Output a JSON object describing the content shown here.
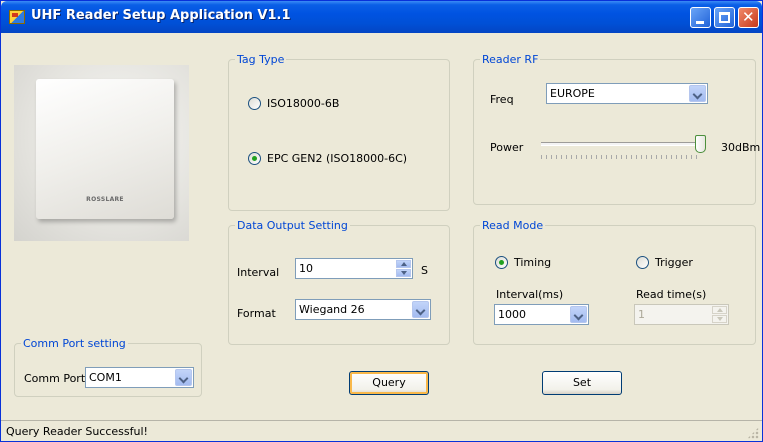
{
  "window": {
    "title": "UHF Reader Setup Application V1.1"
  },
  "photo": {
    "logo_text": "ROSSLARE"
  },
  "tag_type": {
    "legend": "Tag Type",
    "options": [
      {
        "label": "ISO18000-6B",
        "selected": false
      },
      {
        "label": "EPC GEN2 (ISO18000-6C)",
        "selected": true
      }
    ]
  },
  "reader_rf": {
    "legend": "Reader RF",
    "freq_label": "Freq",
    "freq_value": "EUROPE",
    "power_label": "Power",
    "power_value": "30dBm",
    "power_level": 1.0
  },
  "data_output": {
    "legend": "Data Output Setting",
    "interval_label": "Interval",
    "interval_value": "10",
    "interval_unit": "S",
    "format_label": "Format",
    "format_value": "Wiegand 26"
  },
  "read_mode": {
    "legend": "Read Mode",
    "options": [
      {
        "label": "Timing",
        "selected": true
      },
      {
        "label": "Trigger",
        "selected": false
      }
    ],
    "interval_label": "Interval(ms)",
    "interval_value": "1000",
    "read_time_label": "Read time(s)",
    "read_time_value": "1"
  },
  "comm": {
    "legend": "Comm Port setting",
    "port_label": "Comm Port",
    "port_value": "COM1"
  },
  "buttons": {
    "query": "Query",
    "set": "Set"
  },
  "status": {
    "text": "Query Reader Successful!"
  }
}
